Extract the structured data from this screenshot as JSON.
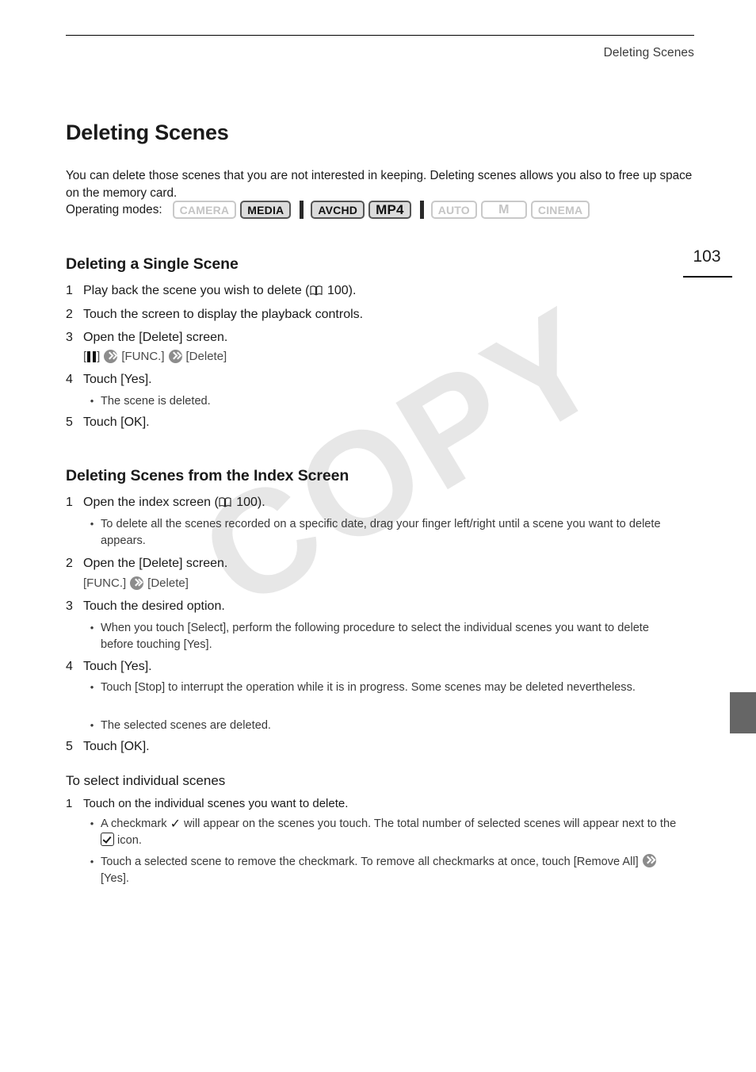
{
  "header": {
    "running_head": "Deleting Scenes",
    "page_number": "103"
  },
  "title": "Deleting Scenes",
  "intro": "You can delete those scenes that you are not interested in keeping. Deleting scenes allows you also to free up space on the memory card.",
  "operating_modes": {
    "label": "Operating modes:",
    "badges": [
      {
        "label": "CAMERA",
        "active": false
      },
      {
        "label": "MEDIA",
        "active": true
      },
      {
        "label": "AVCHD",
        "active": true
      },
      {
        "label": "MP4",
        "active": true
      },
      {
        "label": "AUTO",
        "active": false
      },
      {
        "label": "M",
        "active": false
      },
      {
        "label": "CINEMA",
        "active": false
      }
    ]
  },
  "watermark": "COPY",
  "section_single": {
    "heading": "Deleting a Single Scene",
    "step1_num": "1",
    "step1_a": "Play back the scene you wish to delete (",
    "step1_page": " 100).",
    "step2_num": "2",
    "step2": "Touch the screen to display the playback controls.",
    "step3_num": "3",
    "step3": "Open the [Delete] screen.",
    "step3_path_open": "[",
    "step3_path_close": "]",
    "step3_path_func": "[FUNC.]",
    "step3_path_delete": "[Delete]",
    "step4_num": "4",
    "step4": "Touch [Yes].",
    "step4_bullet": "The scene is deleted.",
    "step5_num": "5",
    "step5": "Touch [OK]."
  },
  "section_index": {
    "heading": "Deleting Scenes from the Index Screen",
    "step1_num": "1",
    "step1_a": "Open the index screen (",
    "step1_page": " 100).",
    "step1_bullet": "To delete all the scenes recorded on a specific date, drag your finger left/right until a scene you want to delete appears.",
    "step2_num": "2",
    "step2": "Open the [Delete] screen.",
    "step2_path_func": "[FUNC.]",
    "step2_path_delete": "[Delete]",
    "step3_num": "3",
    "step3": "Touch the desired option.",
    "step3_bullet": "When you touch [Select], perform the following procedure to select the individual scenes you want to delete before touching [Yes].",
    "step4_num": "4",
    "step4": "Touch [Yes].",
    "step4_bullet1": "Touch [Stop] to interrupt the operation while it is in progress. Some scenes may be deleted nevertheless.",
    "step4_bullet2": "The selected scenes are deleted.",
    "step5_num": "5",
    "step5": "Touch [OK]."
  },
  "section_select": {
    "heading": "To select individual scenes",
    "step1_num": "1",
    "step1": "Touch on the individual scenes you want to delete.",
    "bullet1_a": "A checkmark ",
    "bullet1_b": " will appear on the scenes you touch. The total number of selected scenes will appear next to the ",
    "bullet1_c": " icon.",
    "bullet2_a": "Touch a selected scene to remove the checkmark. To remove all checkmarks at once, touch [Remove All]",
    "bullet2_b": "[Yes]."
  },
  "icons": {
    "book": "book-icon",
    "arrow": "double-chevron-arrow-icon",
    "pause": "pause-icon",
    "check": "✓",
    "checkbox": "checkbox-checked-icon"
  },
  "colors": {
    "text": "#1a1a1a",
    "muted": "#4a4a4a",
    "badge_active_bg": "#dcdcdc",
    "badge_inactive_fg": "#c4c4c4",
    "watermark": "#e7e7e7",
    "edge_tab": "#666666"
  }
}
